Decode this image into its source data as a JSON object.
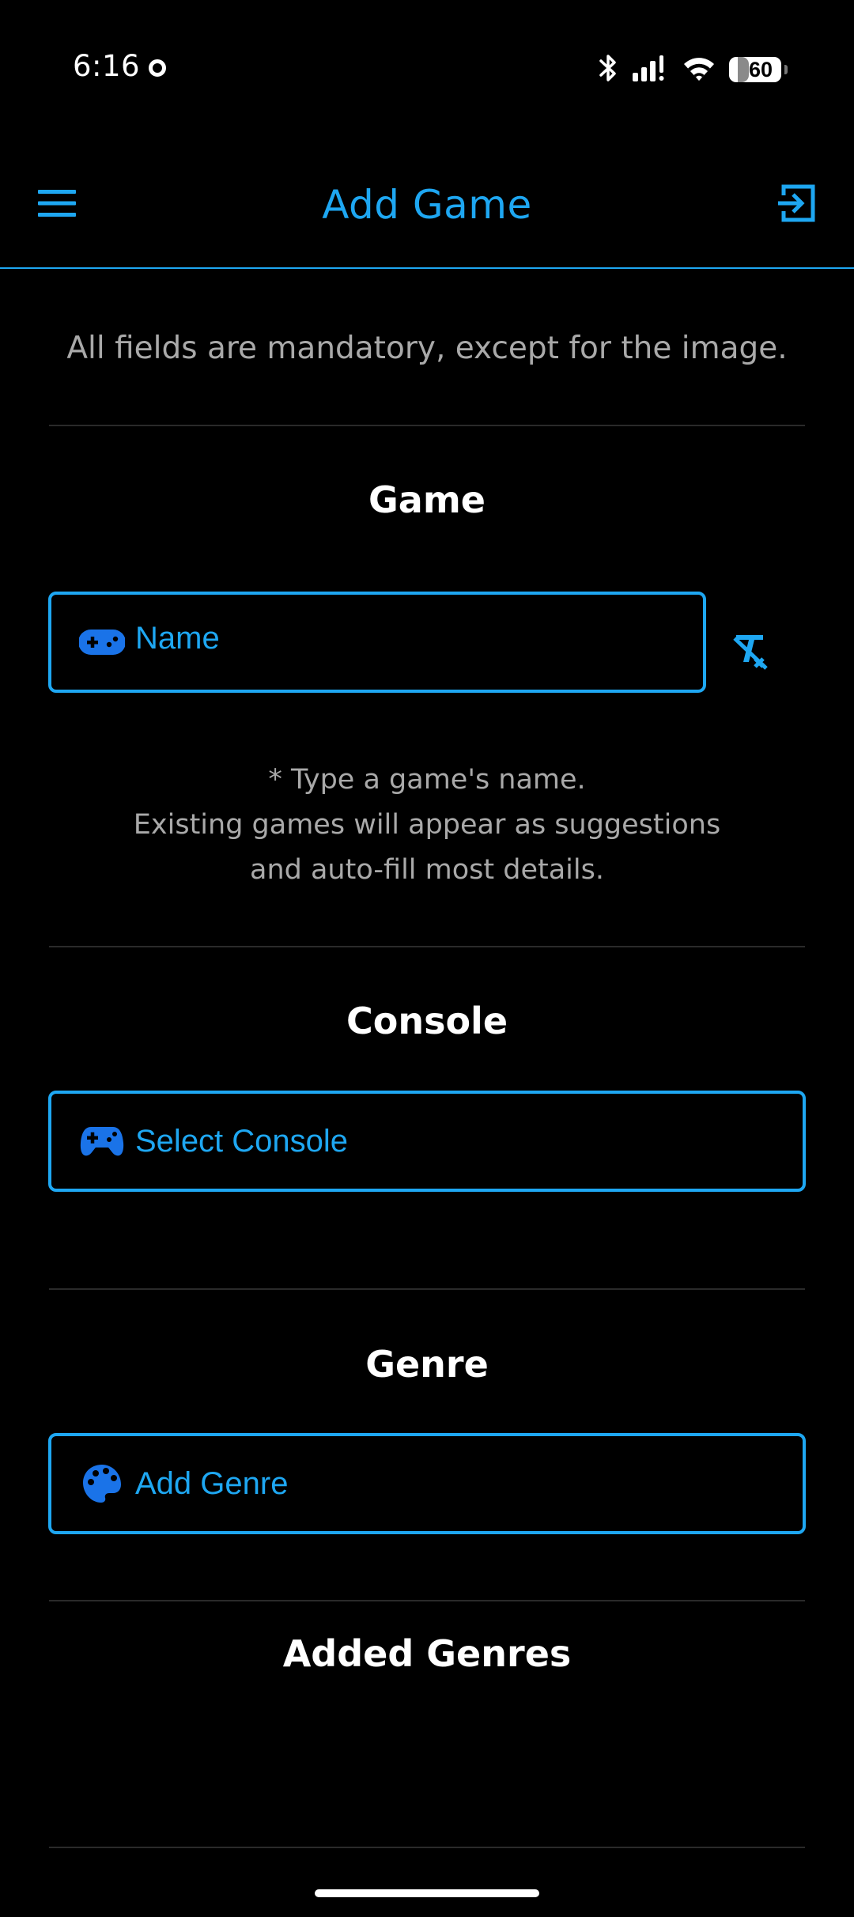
{
  "status_bar": {
    "time": "6:16",
    "battery": "60",
    "icons": [
      "circle-notification-icon",
      "bluetooth-icon",
      "signal-icon",
      "wifi-icon",
      "battery-icon"
    ]
  },
  "app_bar": {
    "title": "Add Game",
    "menu_icon": "hamburger-menu-icon",
    "logout_icon": "exit-icon"
  },
  "form": {
    "note": "All fields are mandatory, except for the image.",
    "game": {
      "title": "Game",
      "name_placeholder": "Name",
      "icon": "gamepad-icon",
      "clear_icon": "clear-format-icon",
      "hint_line1": "* Type a game's name.",
      "hint_line2": "Existing games will appear as suggestions",
      "hint_line3": "and auto-fill most details."
    },
    "console": {
      "title": "Console",
      "select_label": "Select Console",
      "icon": "controller-icon"
    },
    "genre": {
      "title": "Genre",
      "add_label": "Add Genre",
      "icon": "palette-icon"
    },
    "added_genres": {
      "title": "Added Genres"
    }
  },
  "colors": {
    "accent": "#1ea7f2",
    "icon_blue": "#1a73e8",
    "background": "#000000",
    "muted_text": "#a9a9a9"
  }
}
